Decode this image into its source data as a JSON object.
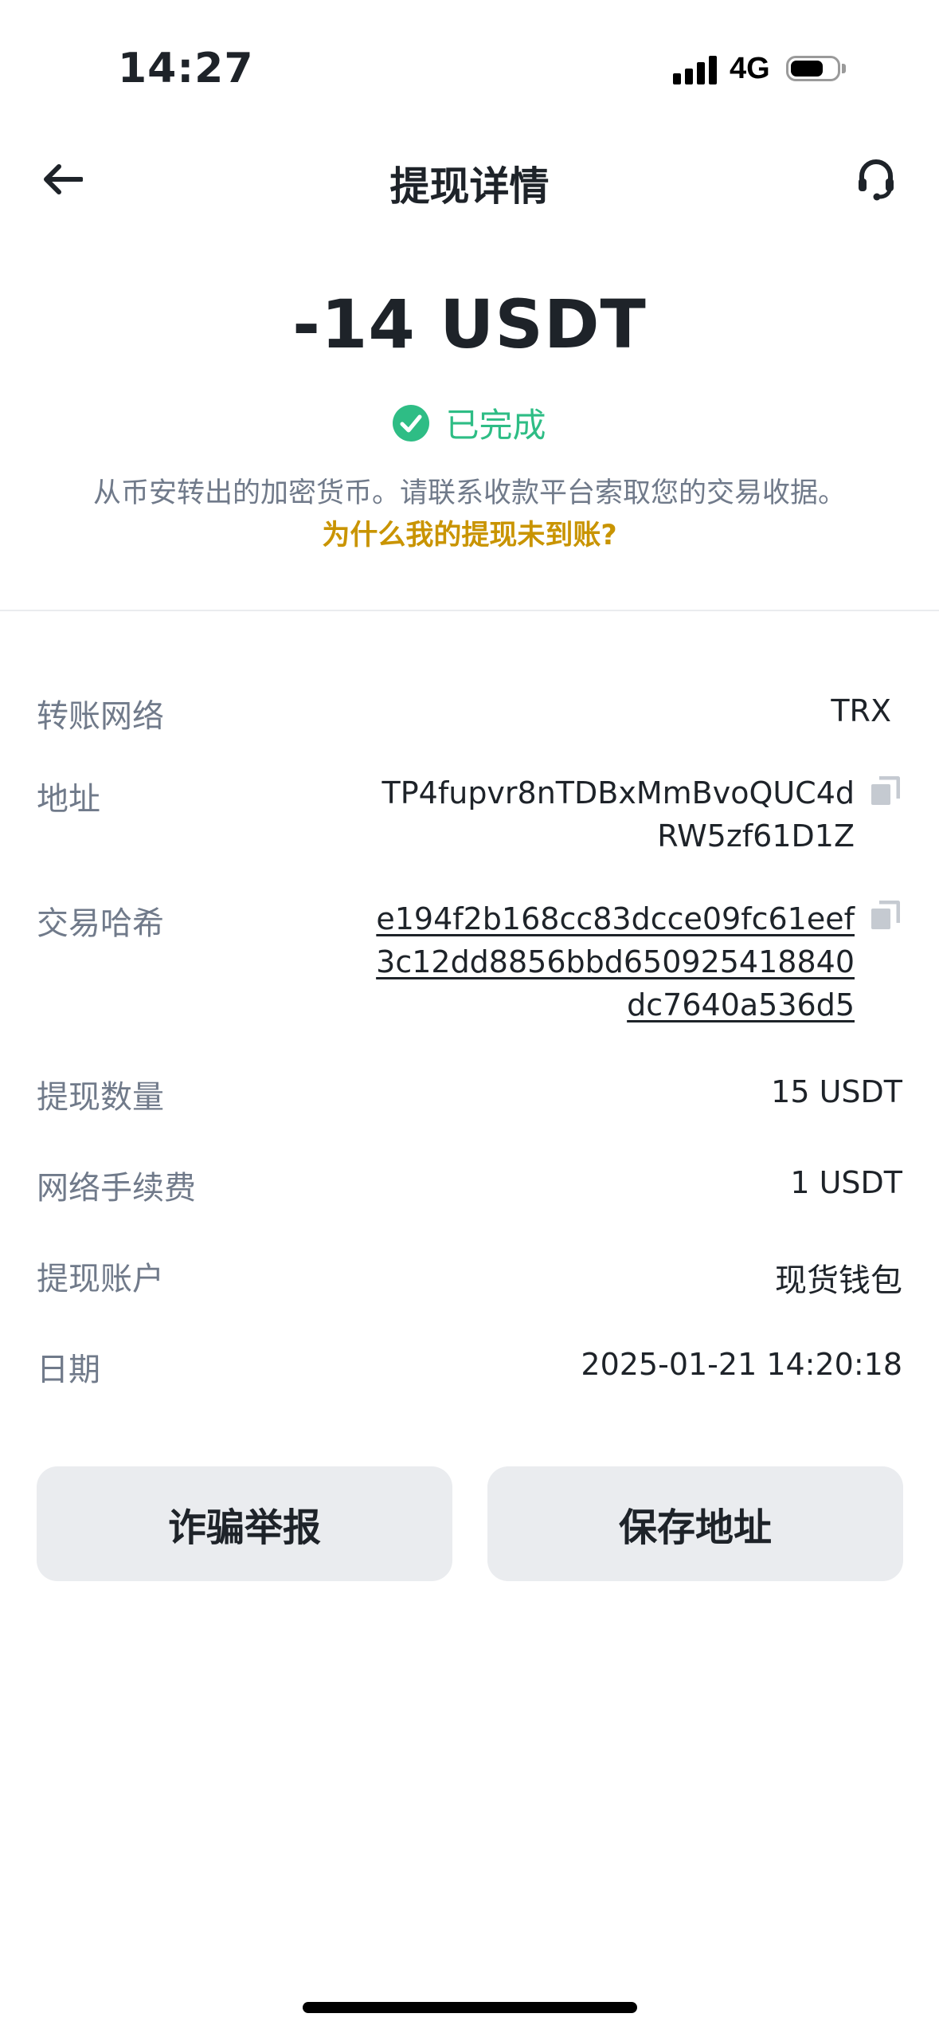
{
  "status_bar": {
    "time": "14:27",
    "network": "4G",
    "battery_level": 0.75,
    "icons": [
      "signal-icon",
      "battery-icon"
    ]
  },
  "header": {
    "title": "提现详情",
    "back_icon": "arrow-left-icon",
    "support_icon": "headset-icon"
  },
  "summary": {
    "amount": "-14 USDT",
    "status": "已完成",
    "status_icon": "check-circle-icon",
    "description": "从币安转出的加密货币。请联系收款平台索取您的交易收据。",
    "help_link": "为什么我的提现未到账?"
  },
  "details": {
    "network_label": "转账网络",
    "network_value": "TRX",
    "address_label": "地址",
    "address_lines": [
      "TP4fupvr8nTDBxMmBvoQUC4d",
      "RW5zf61D1Z"
    ],
    "txid_label": "交易哈希",
    "txid_lines": [
      "e194f2b168cc83dcce09fc61eef",
      "3c12dd8856bbd650925418840",
      "dc7640a536d5"
    ],
    "amount_label": "提现数量",
    "amount_value": "15 USDT",
    "fee_label": "网络手续费",
    "fee_value": "1 USDT",
    "account_label": "提现账户",
    "account_value": "现货钱包",
    "date_label": "日期",
    "date_value": "2025-01-21 14:20:18",
    "copy_icon": "copy-icon"
  },
  "actions": {
    "report_label": "诈骗举报",
    "save_address_label": "保存地址"
  },
  "colors": {
    "success": "#2ebd85",
    "link": "#c99400",
    "label": "#707a8a",
    "text": "#1e2329",
    "button_bg": "#eaecef"
  }
}
